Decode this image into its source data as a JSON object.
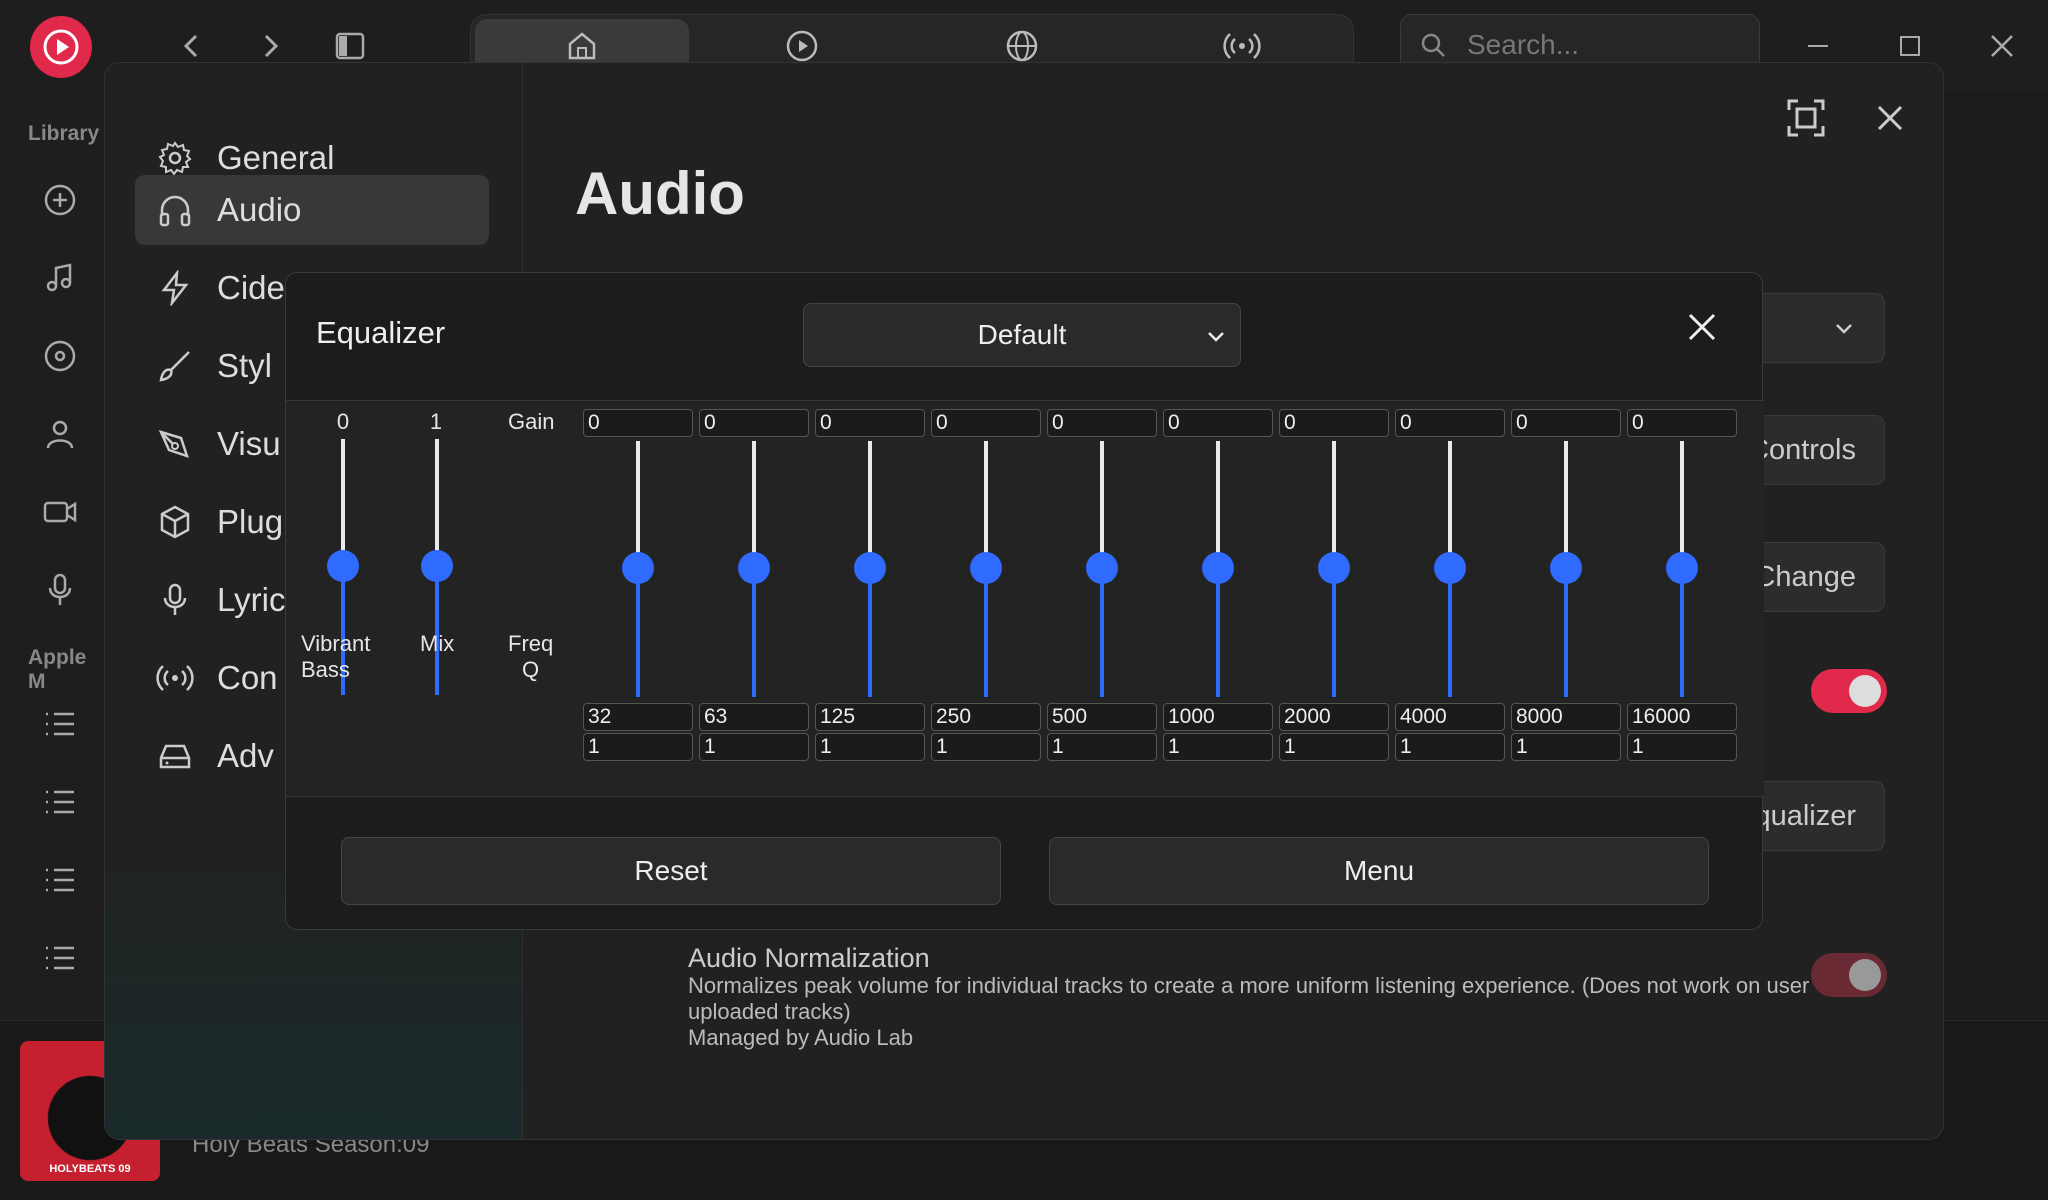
{
  "topbar": {
    "search_placeholder": "Search..."
  },
  "rail": {
    "library_label": "Library",
    "apple_label": "Apple M"
  },
  "settings": {
    "nav": [
      {
        "label": "General",
        "icon": "gear-icon"
      },
      {
        "label": "Audio",
        "icon": "headphones-icon"
      },
      {
        "label": "Cide",
        "icon": "lightning-icon"
      },
      {
        "label": "Styl",
        "icon": "brush-icon"
      },
      {
        "label": "Visu",
        "icon": "pen-icon"
      },
      {
        "label": "Plug",
        "icon": "cube-icon"
      },
      {
        "label": "Lyric",
        "icon": "microphone-icon"
      },
      {
        "label": "Con",
        "icon": "broadcast-icon"
      },
      {
        "label": "Adv",
        "icon": "drive-icon"
      }
    ],
    "page_title": "Audio",
    "controls_label": "Controls",
    "change_label": "Change",
    "equalizer_label": "qualizer",
    "normalization_title": "Audio Normalization",
    "normalization_desc": "Normalizes peak volume for individual tracks to create a more uniform listening experience. (Does not work on user uploaded tracks)",
    "normalization_managed": "Managed by Audio Lab"
  },
  "equalizer": {
    "title": "Equalizer",
    "preset": "Default",
    "vibrant_bass": {
      "label_line1": "Vibrant",
      "label_line2": "Bass",
      "value": "0"
    },
    "mix": {
      "label": "Mix",
      "value": "1"
    },
    "gain_label": "Gain",
    "freq_label": "Freq",
    "q_label": "Q",
    "bands": [
      {
        "gain": "0",
        "freq": "32",
        "q": "1"
      },
      {
        "gain": "0",
        "freq": "63",
        "q": "1"
      },
      {
        "gain": "0",
        "freq": "125",
        "q": "1"
      },
      {
        "gain": "0",
        "freq": "250",
        "q": "1"
      },
      {
        "gain": "0",
        "freq": "500",
        "q": "1"
      },
      {
        "gain": "0",
        "freq": "1000",
        "q": "1"
      },
      {
        "gain": "0",
        "freq": "2000",
        "q": "1"
      },
      {
        "gain": "0",
        "freq": "4000",
        "q": "1"
      },
      {
        "gain": "0",
        "freq": "8000",
        "q": "1"
      },
      {
        "gain": "0",
        "freq": "16000",
        "q": "1"
      }
    ],
    "reset_label": "Reset",
    "menu_label": "Menu"
  },
  "now_playing": {
    "title": "Holy Beats Season:09",
    "art_caption": "HOLYBEATS 09"
  },
  "colors": {
    "accent": "#e0294b",
    "slider_blue": "#2f6bff"
  }
}
